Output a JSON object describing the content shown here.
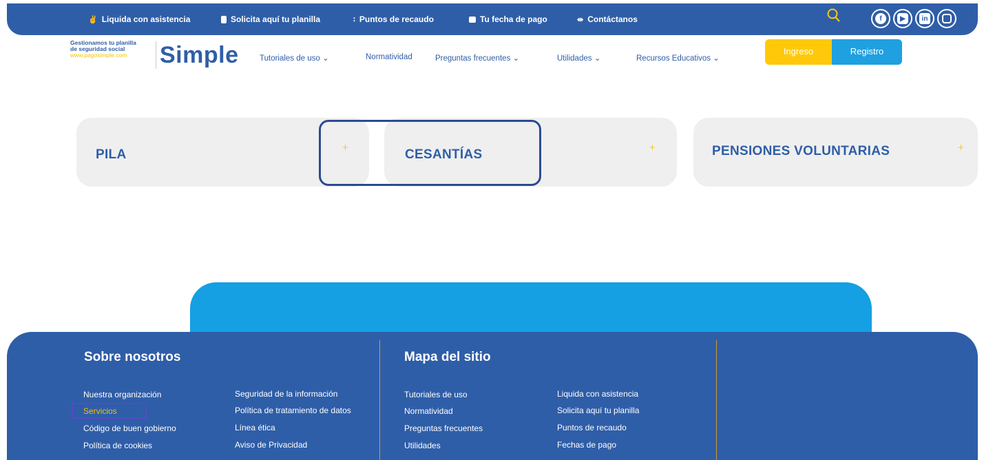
{
  "topbar": {
    "links": [
      {
        "label": "Liquida con asistencia",
        "icon": "hand-icon"
      },
      {
        "label": "Solicita aquí tu planilla",
        "icon": "document-icon"
      },
      {
        "label": "Puntos de recaudo",
        "icon": "share-icon"
      },
      {
        "label": "Tu fecha de pago",
        "icon": "calendar-icon"
      },
      {
        "label": "Contáctanos",
        "icon": "arrows-icon"
      }
    ],
    "search_icon": "search-icon",
    "social": [
      "facebook-icon",
      "youtube-icon",
      "linkedin-icon",
      "instagram-icon"
    ]
  },
  "logo": {
    "tagline_line1": "Gestionamos tu planilla",
    "tagline_line2": "de seguridad social",
    "url": "www.pagosimple.com",
    "word": "Simple"
  },
  "nav": {
    "items": [
      {
        "label": "Tutoriales de uso ⌄"
      },
      {
        "label": "Normatividad"
      },
      {
        "label": "Preguntas frecuentes ⌄"
      },
      {
        "label": "Utilidades ⌄"
      },
      {
        "label": "Recursos Educativos ⌄"
      }
    ],
    "ingreso": "Ingreso",
    "registro": "Registro"
  },
  "accordion": [
    {
      "label": "PILA",
      "plus": "+"
    },
    {
      "label": "CESANTÍAS",
      "plus": "+"
    },
    {
      "label": "PENSIONES VOLUNTARIAS",
      "plus": "+"
    }
  ],
  "footer": {
    "about_title": "Sobre nosotros",
    "about_col1": [
      "Nuestra organización",
      "Servicios",
      "Código de buen gobierno",
      "Política de cookies"
    ],
    "about_col2": [
      "Seguridad de la información",
      "Política de tratamiento de datos",
      "Línea ética",
      "Aviso de Privacidad"
    ],
    "map_title": "Mapa del sitio",
    "map_col1": [
      "Tutoriales de uso",
      "Normatividad",
      "Preguntas frecuentes",
      "Utilidades"
    ],
    "map_col2": [
      "Liquida con asistencia",
      "Solicita aquí tu planilla",
      "Puntos de recaudo",
      "Fechas de pago"
    ]
  },
  "colors": {
    "primary": "#2f5ea8",
    "accent": "#ffc90a",
    "sky": "#1fa0e0"
  }
}
